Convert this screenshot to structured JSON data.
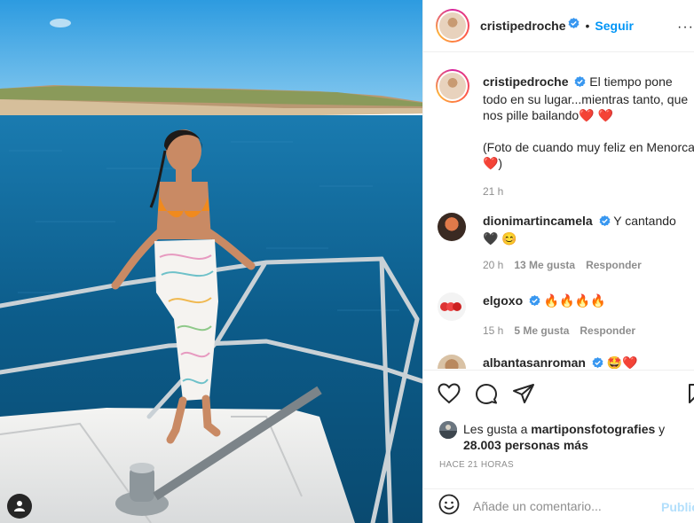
{
  "post": {
    "username": "cristipedroche",
    "follow_label": "Seguir",
    "more_label": "···",
    "separator": "•"
  },
  "caption": {
    "username": "cristipedroche",
    "text": "El tiempo pone todo en su lugar...mientras tanto, que nos pille bailando❤️ ❤️\n\n(Foto de cuando muy feliz en Menorca ❤️)",
    "time": "21 h"
  },
  "comments": [
    {
      "username": "dionimartincamela",
      "text": "Y cantando 🖤 😊",
      "time": "20 h",
      "likes": "13 Me gusta",
      "reply": "Responder"
    },
    {
      "username": "elgoxo",
      "text": "🔥🔥🔥🔥",
      "time": "15 h",
      "likes": "5 Me gusta",
      "reply": "Responder"
    },
    {
      "username": "albantasanroman",
      "text": "🤩❤️",
      "time": "",
      "likes": "",
      "reply": ""
    }
  ],
  "likes_block": {
    "prefix": "Les gusta a ",
    "user": "martiponsfotografies",
    "middle": " y ",
    "count": "28.003 personas más"
  },
  "time_ago": "HACE 21 HORAS",
  "add_comment": {
    "placeholder": "Añade un comentario...",
    "publish_label": "Publicar"
  },
  "icons": [
    "heart-icon",
    "comment-icon",
    "share-icon",
    "bookmark-icon",
    "emoji-icon",
    "user-tag-icon",
    "verified-icon"
  ],
  "colors": {
    "accent": "#0095f6",
    "verified": "#3897f0",
    "sea": "#0d5a86",
    "sky": "#5ab6ea"
  }
}
